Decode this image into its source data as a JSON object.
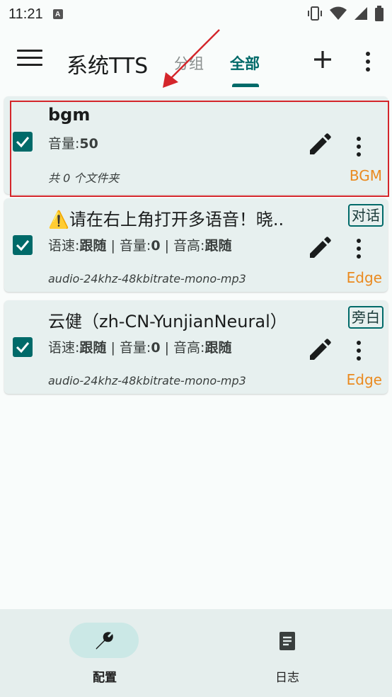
{
  "status_bar": {
    "time": "11:21",
    "app_icon_letter": "A",
    "icons": [
      "vibrate-icon",
      "wifi-icon",
      "signal-icon",
      "battery-icon"
    ]
  },
  "top_bar": {
    "title": "系统TTS",
    "tabs": [
      {
        "label": "分组",
        "active": false
      },
      {
        "label": "全部",
        "active": true
      }
    ],
    "accent_color": "#006a69"
  },
  "cards": [
    {
      "title": "bgm",
      "info": [
        {
          "label": "音量:",
          "value": "50"
        }
      ],
      "sub": "共 0 个文件夹",
      "tag": "BGM",
      "badge": "",
      "checked": true
    },
    {
      "title_emoji": "⚠️",
      "title": "请在右上角打开多语音！晓..",
      "info": [
        {
          "label": "语速:",
          "value": "跟随"
        },
        {
          "label": "音量:",
          "value": "0"
        },
        {
          "label": "音高:",
          "value": "跟随"
        }
      ],
      "sub": "audio-24khz-48kbitrate-mono-mp3",
      "tag": "Edge",
      "badge": "对话",
      "checked": true
    },
    {
      "title": "云健（zh-CN-YunjianNeural）",
      "info": [
        {
          "label": "语速:",
          "value": "跟随"
        },
        {
          "label": "音量:",
          "value": "0"
        },
        {
          "label": "音高:",
          "value": "跟随"
        }
      ],
      "sub": "audio-24khz-48kbitrate-mono-mp3",
      "tag": "Edge",
      "badge": "旁白",
      "checked": true
    }
  ],
  "bottom_nav": [
    {
      "label": "配置",
      "icon": "wrench-icon",
      "active": true
    },
    {
      "label": "日志",
      "icon": "document-icon",
      "active": false
    }
  ],
  "annotation": {
    "color": "#d4262b"
  }
}
